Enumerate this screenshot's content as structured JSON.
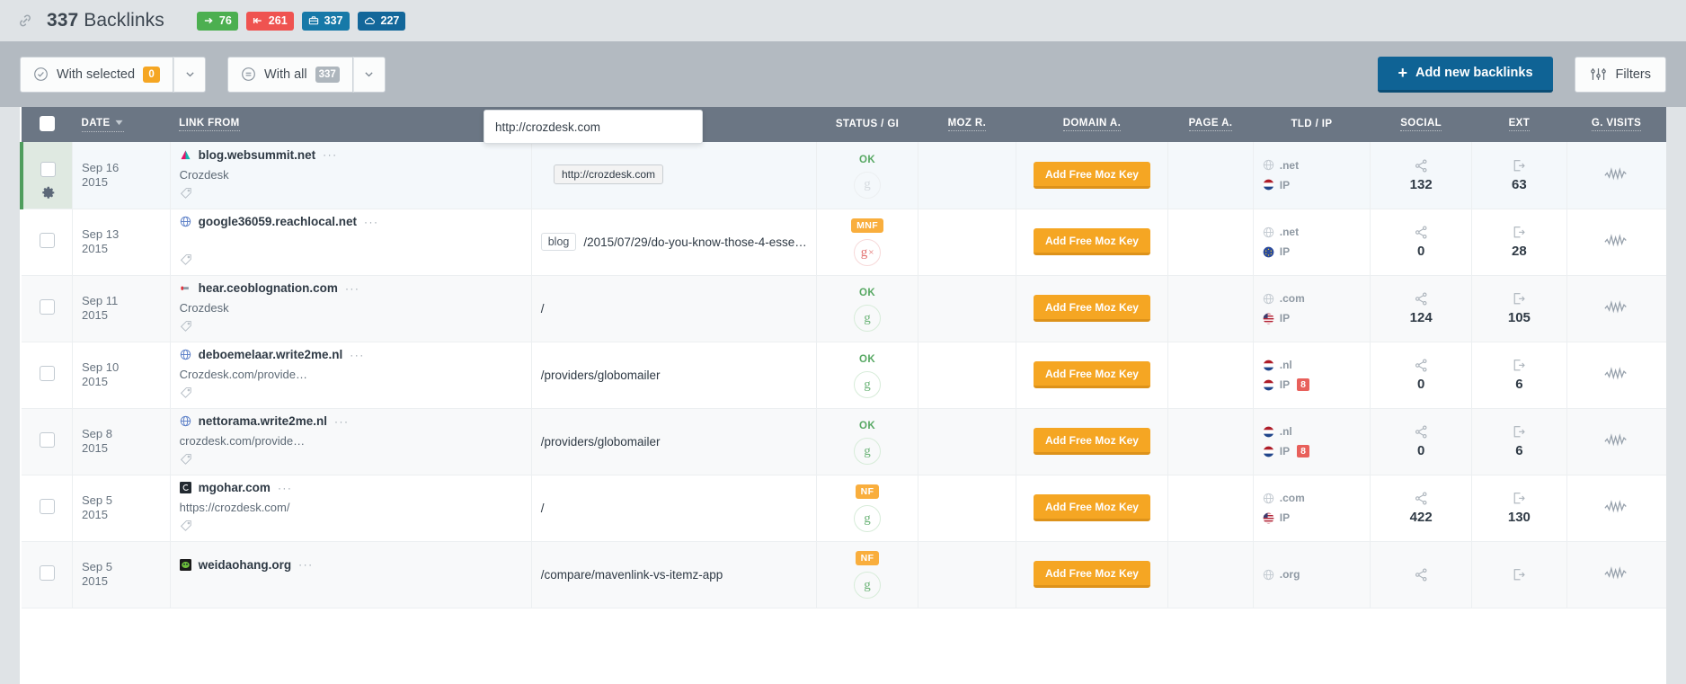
{
  "header": {
    "count": "337",
    "title_word": "Backlinks",
    "link_icon": "link-icon",
    "chips": [
      {
        "icon": "arrow-right-icon",
        "value": "76",
        "color": "#4caf50"
      },
      {
        "icon": "arrow-to-bar-icon",
        "value": "261",
        "color": "#ef5350"
      },
      {
        "icon": "briefcase-icon",
        "value": "337",
        "color": "#1779a8"
      },
      {
        "icon": "cloud-icon",
        "value": "227",
        "color": "#13679a"
      }
    ]
  },
  "toolbar": {
    "with_selected_label": "With selected",
    "with_selected_count": "0",
    "with_all_label": "With all",
    "with_all_count": "337",
    "add_backlinks_label": "Add new backlinks",
    "add_backlinks_plus": "+",
    "filters_label": "Filters",
    "primary_color": "#0f6395",
    "accent_orange": "#f5a623"
  },
  "overlay": {
    "url_input_value": "http://crozdesk.com",
    "url_tooltip": "http://crozdesk.com"
  },
  "table": {
    "columns": [
      {
        "key": "check",
        "label": "",
        "sortable": false
      },
      {
        "key": "date",
        "label": "DATE",
        "sortable": true,
        "sorted": "desc"
      },
      {
        "key": "link",
        "label": "LINK FROM",
        "sortable": true
      },
      {
        "key": "page",
        "label": "",
        "sortable": false
      },
      {
        "key": "status",
        "label": "STATUS / GI",
        "sortable": false
      },
      {
        "key": "moz",
        "label": "MOZ R.",
        "sortable": true
      },
      {
        "key": "domain",
        "label": "DOMAIN A.",
        "sortable": true
      },
      {
        "key": "pagea",
        "label": "PAGE A.",
        "sortable": true
      },
      {
        "key": "tld",
        "label": "TLD / IP",
        "sortable": false
      },
      {
        "key": "social",
        "label": "SOCIAL",
        "sortable": true
      },
      {
        "key": "ext",
        "label": "EXT",
        "sortable": true
      },
      {
        "key": "visits",
        "label": "G. VISITS",
        "sortable": true
      }
    ],
    "moz_button_label": "Add Free Moz Key",
    "rows": [
      {
        "date_day": "Sep 16",
        "date_year": "2015",
        "domain": "blog.websummit.net",
        "favicon": "triangle-pink-teal",
        "anchor": "Crozdesk",
        "tag_icon": "tag-icon",
        "page_prefix": "",
        "page_path": "",
        "status": "OK",
        "status_type": "ok",
        "g_state": "grey",
        "tld": ".net",
        "tld_flag": "globe",
        "ip_label": "IP",
        "ip_flag": "nl",
        "ip_badge": "",
        "social": "132",
        "ext": "63",
        "visits": "sparkline",
        "highlight": true,
        "gear": true
      },
      {
        "date_day": "Sep 13",
        "date_year": "2015",
        "domain": "google36059.reachlocal.net",
        "favicon": "globe-blue",
        "anchor": "",
        "tag_icon": "tag-icon",
        "page_prefix": "blog",
        "page_path": "/2015/07/29/do-you-know-those-4-esse…",
        "status": "MNF",
        "status_type": "badge",
        "g_state": "red",
        "tld": ".net",
        "tld_flag": "globe",
        "ip_label": "IP",
        "ip_flag": "eu",
        "ip_badge": "",
        "social": "0",
        "ext": "28",
        "visits": "sparkline",
        "highlight": false,
        "gear": false
      },
      {
        "date_day": "Sep 11",
        "date_year": "2015",
        "domain": "hear.ceoblognation.com",
        "favicon": "red-flag",
        "anchor": "Crozdesk",
        "tag_icon": "tag-icon",
        "page_prefix": "",
        "page_path": "/",
        "status": "OK",
        "status_type": "ok",
        "g_state": "green",
        "tld": ".com",
        "tld_flag": "globe",
        "ip_label": "IP",
        "ip_flag": "us",
        "ip_badge": "",
        "social": "124",
        "ext": "105",
        "visits": "sparkline",
        "highlight": false,
        "gear": false
      },
      {
        "date_day": "Sep 10",
        "date_year": "2015",
        "domain": "deboemelaar.write2me.nl",
        "favicon": "globe-blue",
        "anchor": "Crozdesk.com/provide…",
        "tag_icon": "tag-icon",
        "page_prefix": "",
        "page_path": "/providers/globomailer",
        "status": "OK",
        "status_type": "ok",
        "g_state": "green",
        "tld": ".nl",
        "tld_flag": "nl",
        "ip_label": "IP",
        "ip_flag": "nl",
        "ip_badge": "8",
        "social": "0",
        "ext": "6",
        "visits": "sparkline",
        "highlight": false,
        "gear": false
      },
      {
        "date_day": "Sep 8",
        "date_year": "2015",
        "domain": "nettorama.write2me.nl",
        "favicon": "globe-blue",
        "anchor": "crozdesk.com/provide…",
        "tag_icon": "tag-icon",
        "page_prefix": "",
        "page_path": "/providers/globomailer",
        "status": "OK",
        "status_type": "ok",
        "g_state": "green",
        "tld": ".nl",
        "tld_flag": "nl",
        "ip_label": "IP",
        "ip_flag": "nl",
        "ip_badge": "8",
        "social": "0",
        "ext": "6",
        "visits": "sparkline",
        "highlight": false,
        "gear": false
      },
      {
        "date_day": "Sep 5",
        "date_year": "2015",
        "domain": "mgohar.com",
        "favicon": "dark-square",
        "anchor": "https://crozdesk.com/",
        "tag_icon": "tag-icon",
        "page_prefix": "",
        "page_path": "/",
        "status": "NF",
        "status_type": "badge",
        "g_state": "green",
        "tld": ".com",
        "tld_flag": "globe",
        "ip_label": "IP",
        "ip_flag": "us",
        "ip_badge": "",
        "social": "422",
        "ext": "130",
        "visits": "sparkline",
        "highlight": false,
        "gear": false
      },
      {
        "date_day": "Sep 5",
        "date_year": "2015",
        "domain": "weidaohang.org",
        "favicon": "green-square",
        "anchor": "",
        "tag_icon": "",
        "page_prefix": "",
        "page_path": "/compare/mavenlink-vs-itemz-app",
        "status": "NF",
        "status_type": "badge",
        "g_state": "green",
        "tld": ".org",
        "tld_flag": "globe",
        "ip_label": "",
        "ip_flag": "",
        "ip_badge": "",
        "social": "",
        "ext": "",
        "visits": "sparkline",
        "highlight": false,
        "gear": false
      }
    ]
  }
}
